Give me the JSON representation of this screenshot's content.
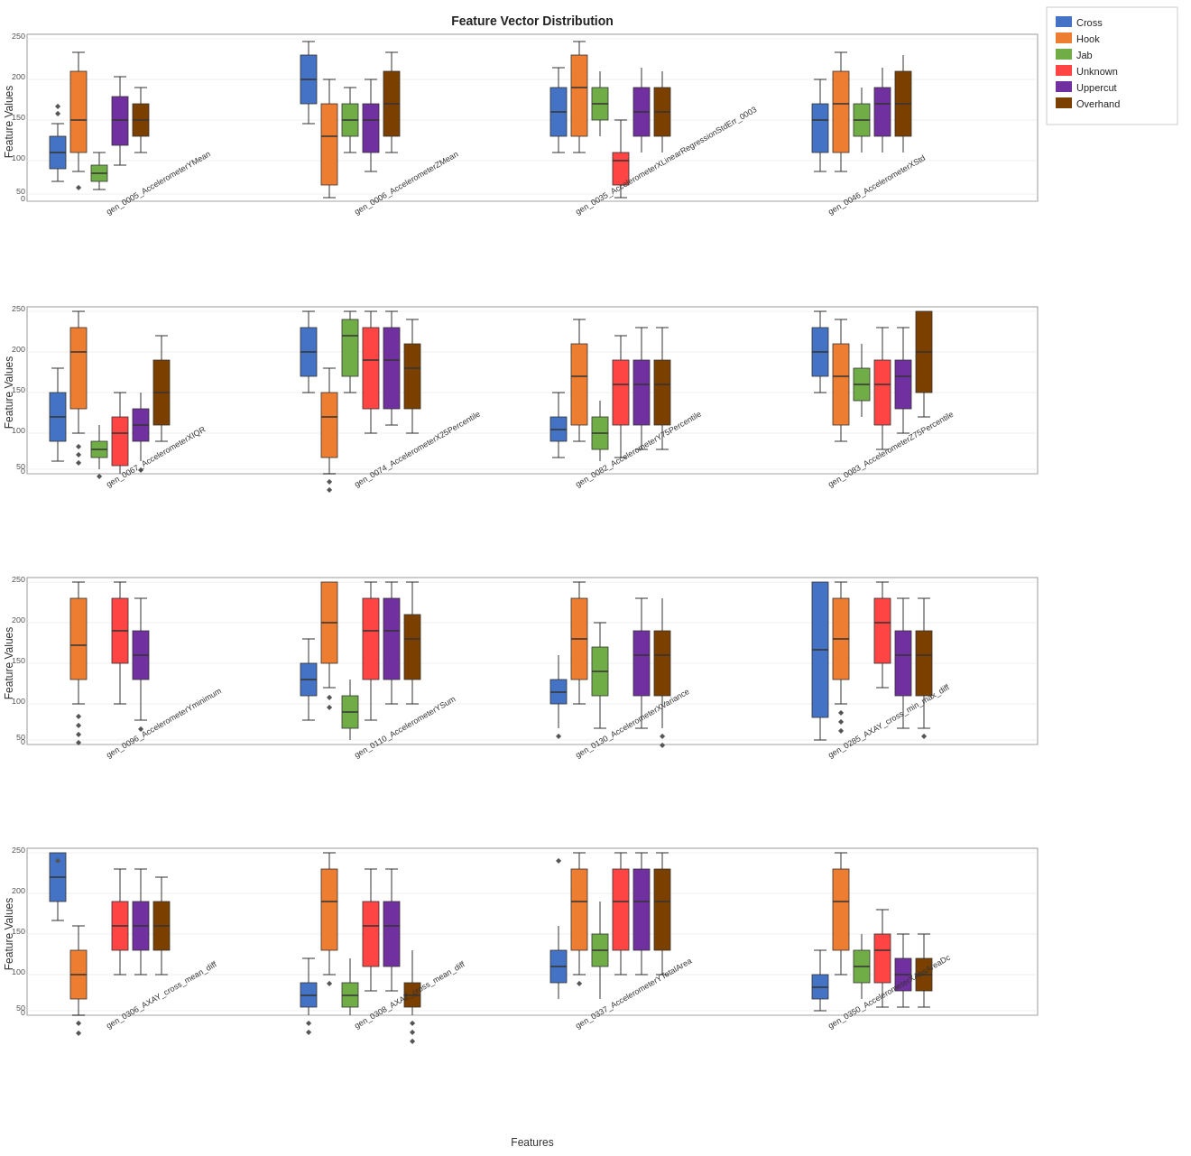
{
  "title": "Feature Vector Distribution",
  "xAxisLabel": "Features",
  "yAxisLabel": "Feature Values",
  "legend": {
    "items": [
      {
        "label": "Cross",
        "color": "#4472C4"
      },
      {
        "label": "Hook",
        "color": "#ED7D31"
      },
      {
        "label": "Jab",
        "color": "#70AD47"
      },
      {
        "label": "Unknown",
        "color": "#FF0000"
      },
      {
        "label": "Uppercut",
        "color": "#7030A0"
      },
      {
        "label": "Overhand",
        "color": "#7B3F00"
      }
    ]
  },
  "rows": [
    {
      "features": [
        "gen_0005_AccelerometerYMean",
        "gen_0006_AccelerometerZMean",
        "gen_0035_AccelerometerXLinearRegressionStdErr_0003",
        "gen_0046_AccelerometerXStd"
      ]
    },
    {
      "features": [
        "gen_0067_AccelerometerXIQR",
        "gen_0074_AccelerometerX25Percentile",
        "gen_0082_AccelerometerY75Percentile",
        "gen_0083_AccelerometerZ75Percentile"
      ]
    },
    {
      "features": [
        "gen_0096_AccelerometerYminimum",
        "gen_0110_AccelerometerYSum",
        "gen_0130_AccelerometerXVariance",
        "gen_0285_AXAY_cross_min_max_diff"
      ]
    },
    {
      "features": [
        "gen_0306_AXAY_cross_mean_diff",
        "gen_0308_AXAZ_cross_mean_diff",
        "gen_0337_AccelerometerYTotalArea",
        "gen_0350_AccelerometerXAbsAreaDc"
      ]
    }
  ]
}
